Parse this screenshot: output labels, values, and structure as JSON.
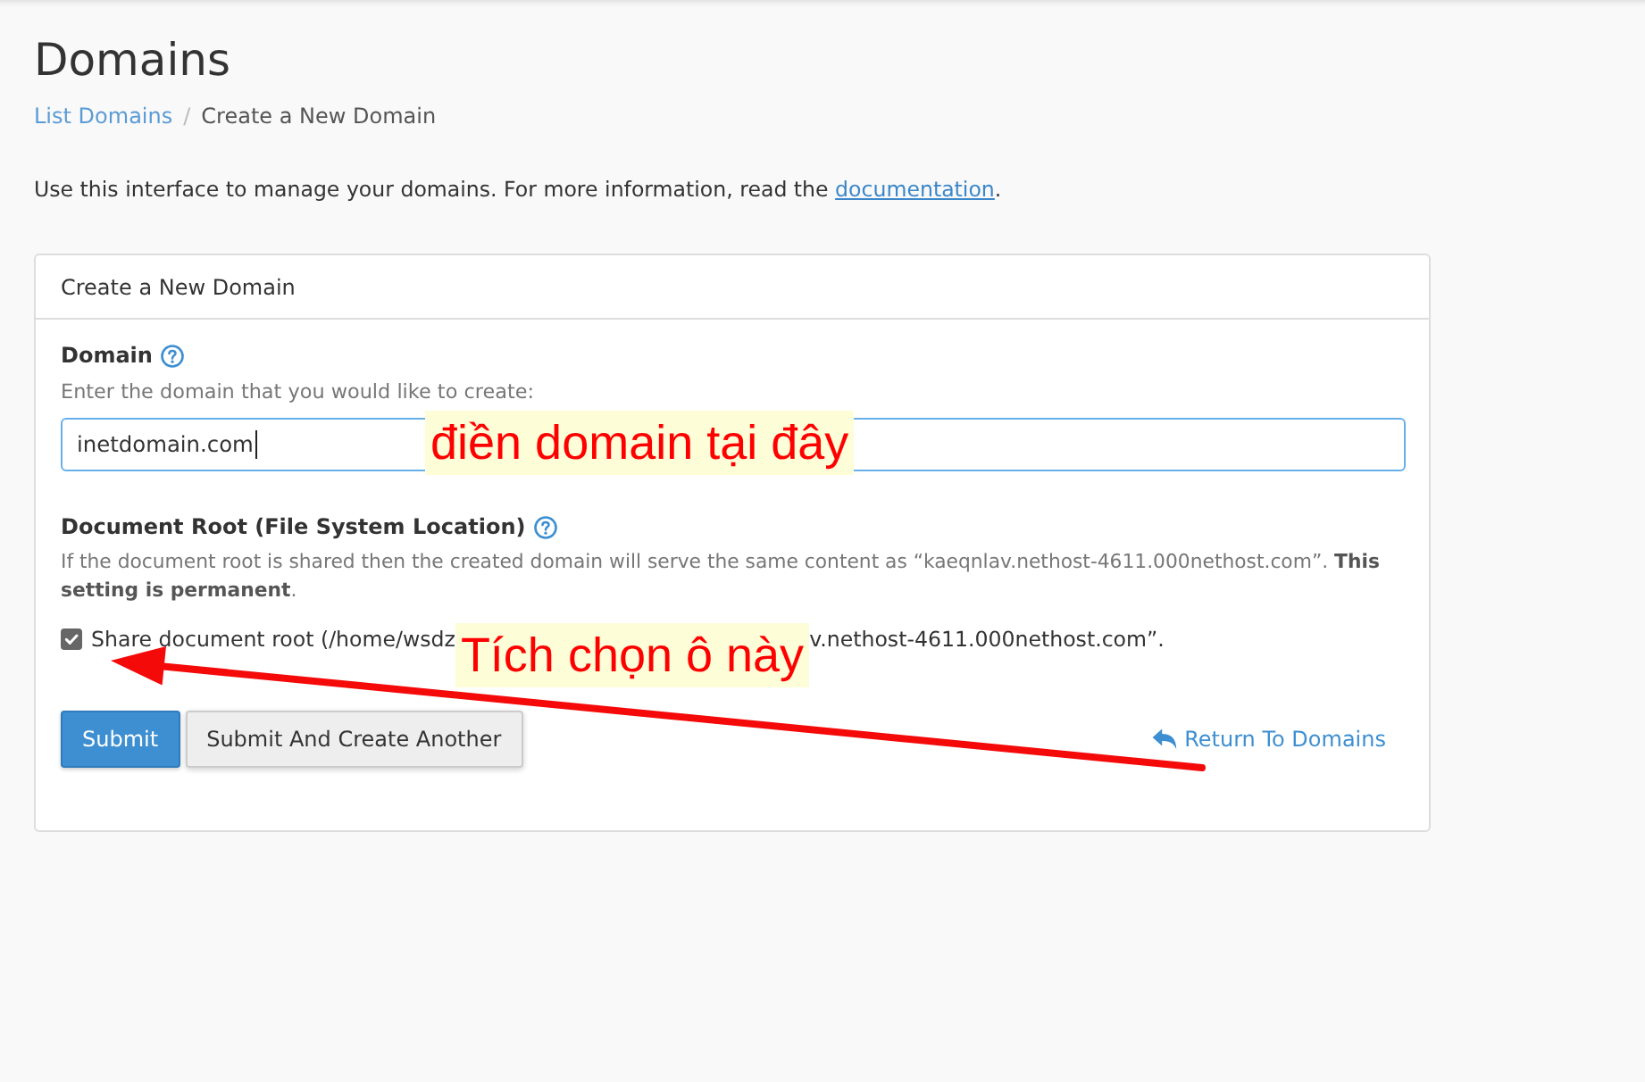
{
  "page": {
    "title": "Domains"
  },
  "breadcrumb": {
    "items": [
      {
        "label": "List Domains",
        "kind": "link"
      },
      {
        "label": "Create a New Domain",
        "kind": "current"
      }
    ],
    "separator": "/"
  },
  "intro": {
    "text": "Use this interface to manage your domains. For more information, read the ",
    "link": "documentation",
    "end": "."
  },
  "panel": {
    "title": "Create a New Domain",
    "domain_field": {
      "label": "Domain",
      "hint": "Enter the domain that you would like to create:",
      "value": "inetdomain.com",
      "focused": true,
      "annotation": "điền domain tại đây"
    },
    "document_root": {
      "label": "Document Root (File System Location)",
      "description": "If the document root is shared then the created domain will serve the same content as “kaeqnlav.nethost-4611.000nethost.com”. **This setting is permanent**.",
      "checkbox": {
        "checked": true,
        "label_start": "Share document root (/home/wsdz",
        "annotation": "Tích chọn ô này",
        "label_end": "v.nethost-4611.000nethost.com”."
      }
    },
    "buttons": [
      {
        "label": "Submit",
        "kind": "primary"
      },
      {
        "label": "Submit And Create Another",
        "kind": "default"
      }
    ],
    "return_link": "Return To Domains"
  }
}
